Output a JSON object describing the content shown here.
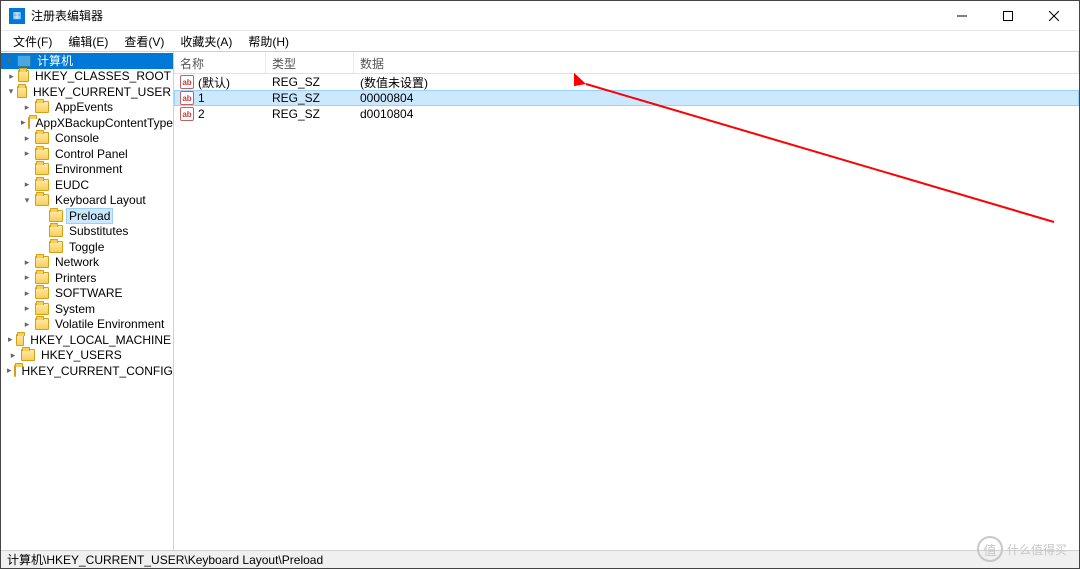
{
  "window": {
    "title": "注册表编辑器"
  },
  "menu": {
    "file": "文件(F)",
    "edit": "编辑(E)",
    "view": "查看(V)",
    "fav": "收藏夹(A)",
    "help": "帮助(H)"
  },
  "tree": {
    "root": "计算机",
    "nodes": [
      {
        "label": "HKEY_CLASSES_ROOT",
        "indent": 1,
        "exp": ">"
      },
      {
        "label": "HKEY_CURRENT_USER",
        "indent": 1,
        "exp": "v"
      },
      {
        "label": "AppEvents",
        "indent": 2,
        "exp": ">"
      },
      {
        "label": "AppXBackupContentType",
        "indent": 2,
        "exp": ">"
      },
      {
        "label": "Console",
        "indent": 2,
        "exp": ">"
      },
      {
        "label": "Control Panel",
        "indent": 2,
        "exp": ">"
      },
      {
        "label": "Environment",
        "indent": 2,
        "exp": ""
      },
      {
        "label": "EUDC",
        "indent": 2,
        "exp": ">"
      },
      {
        "label": "Keyboard Layout",
        "indent": 2,
        "exp": "v"
      },
      {
        "label": "Preload",
        "indent": 3,
        "exp": "",
        "selected": true
      },
      {
        "label": "Substitutes",
        "indent": 3,
        "exp": ""
      },
      {
        "label": "Toggle",
        "indent": 3,
        "exp": ""
      },
      {
        "label": "Network",
        "indent": 2,
        "exp": ">"
      },
      {
        "label": "Printers",
        "indent": 2,
        "exp": ">"
      },
      {
        "label": "SOFTWARE",
        "indent": 2,
        "exp": ">"
      },
      {
        "label": "System",
        "indent": 2,
        "exp": ">"
      },
      {
        "label": "Volatile Environment",
        "indent": 2,
        "exp": ">"
      },
      {
        "label": "HKEY_LOCAL_MACHINE",
        "indent": 1,
        "exp": ">"
      },
      {
        "label": "HKEY_USERS",
        "indent": 1,
        "exp": ">"
      },
      {
        "label": "HKEY_CURRENT_CONFIG",
        "indent": 1,
        "exp": ">"
      }
    ]
  },
  "list": {
    "cols": {
      "name": "名称",
      "type": "类型",
      "data": "数据"
    },
    "rows": [
      {
        "name": "(默认)",
        "type": "REG_SZ",
        "data": "(数值未设置)",
        "selected": false
      },
      {
        "name": "1",
        "type": "REG_SZ",
        "data": "00000804",
        "selected": true
      },
      {
        "name": "2",
        "type": "REG_SZ",
        "data": "d0010804",
        "selected": false
      }
    ]
  },
  "status": {
    "path": "计算机\\HKEY_CURRENT_USER\\Keyboard Layout\\Preload"
  },
  "watermark": {
    "text": "什么值得买",
    "logo": "值"
  }
}
